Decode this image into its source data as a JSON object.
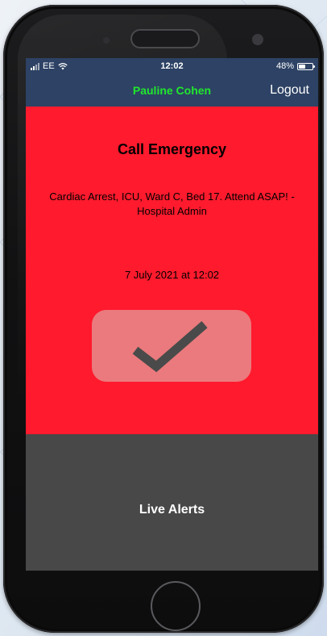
{
  "status_bar": {
    "carrier": "EE",
    "time": "12:02",
    "battery_percent_label": "48%",
    "battery_level": 0.48
  },
  "header": {
    "user_name": "Pauline Cohen",
    "logout_label": "Logout"
  },
  "alert": {
    "title": "Call Emergency",
    "message": "Cardiac Arrest, ICU, Ward C, Bed 17. Attend ASAP! - Hospital Admin",
    "datetime": "7 July 2021 at 12:02",
    "acknowledge_icon": "checkmark-icon"
  },
  "footer": {
    "live_alerts_label": "Live Alerts"
  },
  "colors": {
    "nav_background": "#2d4264",
    "user_name": "#21e62e",
    "alert_background": "#ff1a2d",
    "acknowledge_button": "#ea7a7d",
    "checkmark": "#4a4a4a",
    "footer_background": "#484848"
  }
}
